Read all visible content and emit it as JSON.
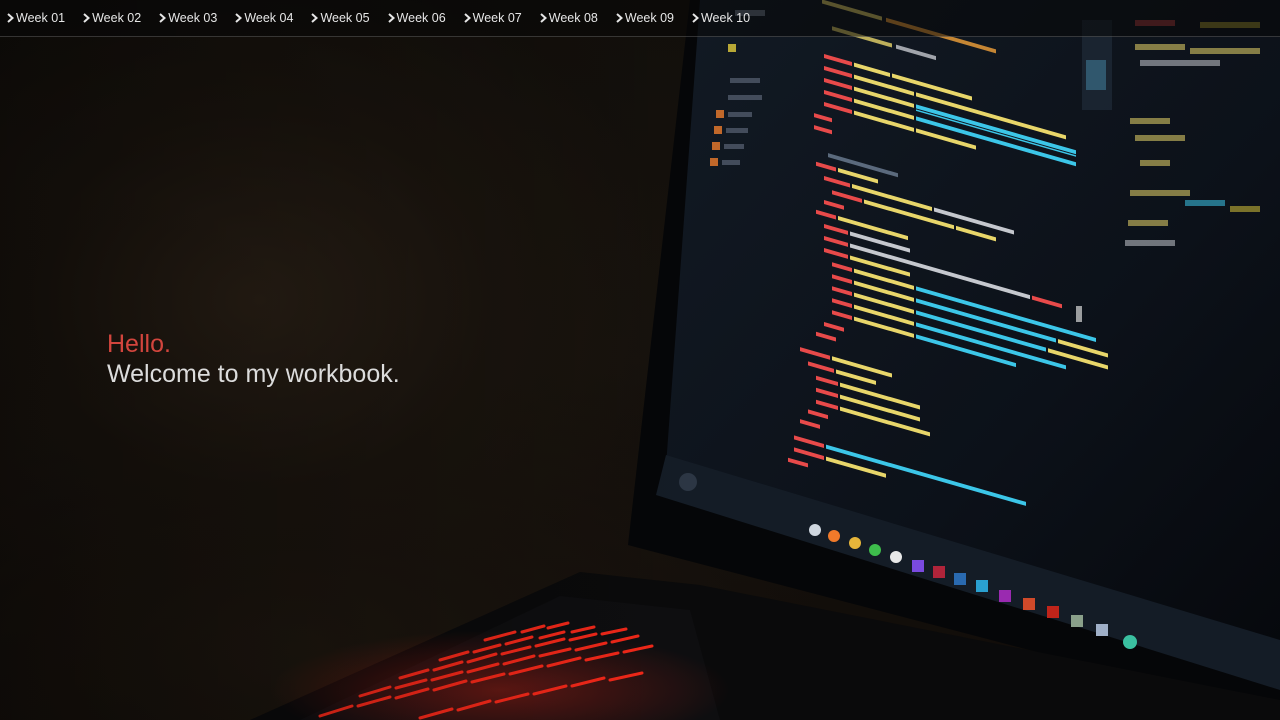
{
  "nav": {
    "items": [
      {
        "label": "Week 01"
      },
      {
        "label": "Week 02"
      },
      {
        "label": "Week 03"
      },
      {
        "label": "Week 04"
      },
      {
        "label": "Week 05"
      },
      {
        "label": "Week 06"
      },
      {
        "label": "Week 07"
      },
      {
        "label": "Week 08"
      },
      {
        "label": "Week 09"
      },
      {
        "label": "Week 10"
      }
    ],
    "item_icon": "chevron-right-icon"
  },
  "hero": {
    "greeting": "Hello.",
    "subtitle": "Welcome to my workbook."
  },
  "colors": {
    "greeting": "#d2453d",
    "subtitle": "#dcdcdc",
    "nav_text": "#e6e6e6",
    "keyboard_glow": "#ff2a1a"
  }
}
